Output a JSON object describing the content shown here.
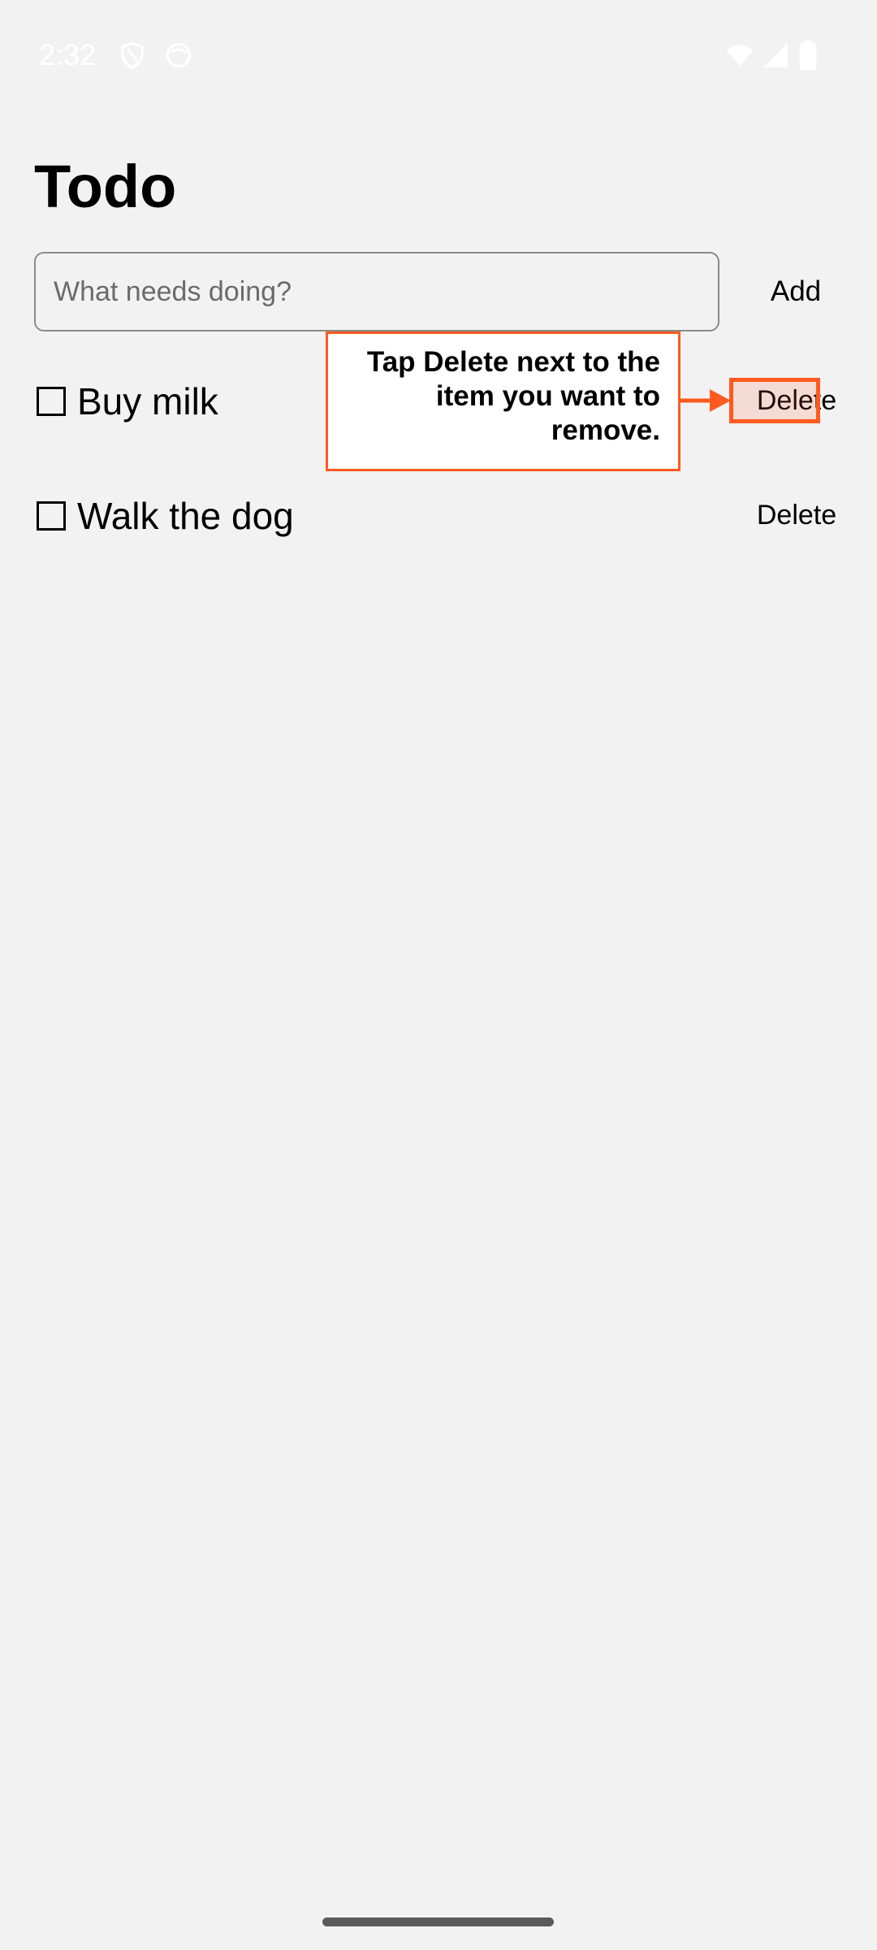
{
  "status_bar": {
    "time": "2:32",
    "left_icons": [
      "shield-icon",
      "face-icon"
    ],
    "right_icons": [
      "wifi-icon",
      "cellular-icon",
      "battery-icon"
    ]
  },
  "header": {
    "title": "Todo"
  },
  "new_todo": {
    "value": "",
    "placeholder": "What needs doing?",
    "add_label": "Add"
  },
  "todos": [
    {
      "checkbox_icon": "unchecked-checkbox-icon",
      "text": "Buy milk",
      "checked": false,
      "delete_label": "Delete"
    },
    {
      "checkbox_icon": "unchecked-checkbox-icon",
      "text": "Walk the dog",
      "checked": false,
      "delete_label": "Delete"
    }
  ],
  "annotation": {
    "text": "Tap Delete next to the item you want to remove.",
    "accent_color": "#ff5a1f"
  },
  "colors": {
    "background": "#f2f2f2",
    "text": "#000000",
    "status_bar_text": "#ffffff"
  }
}
